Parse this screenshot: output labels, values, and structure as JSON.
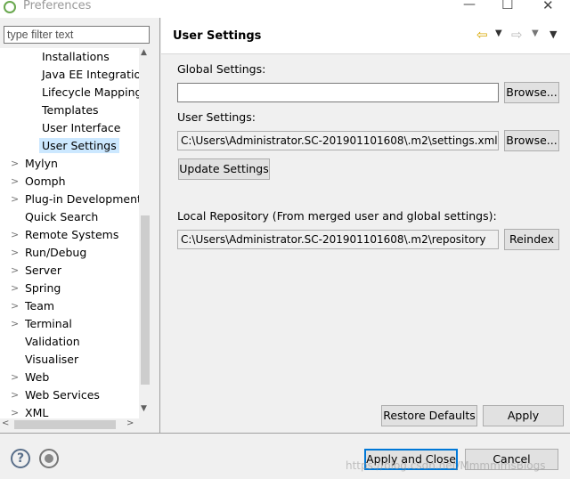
{
  "window": {
    "title": "Preferences"
  },
  "filter": {
    "placeholder": "type filter text"
  },
  "tree": {
    "items": [
      {
        "label": "Installations",
        "expandable": false
      },
      {
        "label": "Java EE Integration",
        "expandable": false
      },
      {
        "label": "Lifecycle Mapping",
        "expandable": false
      },
      {
        "label": "Templates",
        "expandable": false
      },
      {
        "label": "User Interface",
        "expandable": false
      },
      {
        "label": "User Settings",
        "expandable": false,
        "selected": true
      },
      {
        "label": "Mylyn",
        "expandable": true
      },
      {
        "label": "Oomph",
        "expandable": true
      },
      {
        "label": "Plug-in Development",
        "expandable": true
      },
      {
        "label": "Quick Search",
        "expandable": false
      },
      {
        "label": "Remote Systems",
        "expandable": true
      },
      {
        "label": "Run/Debug",
        "expandable": true
      },
      {
        "label": "Server",
        "expandable": true
      },
      {
        "label": "Spring",
        "expandable": true
      },
      {
        "label": "Team",
        "expandable": true
      },
      {
        "label": "Terminal",
        "expandable": true
      },
      {
        "label": "Validation",
        "expandable": false
      },
      {
        "label": "Visualiser",
        "expandable": false
      },
      {
        "label": "Web",
        "expandable": true
      },
      {
        "label": "Web Services",
        "expandable": true
      },
      {
        "label": "XML",
        "expandable": true
      }
    ]
  },
  "page": {
    "title": "User Settings",
    "global_settings_label": "Global Settings:",
    "global_settings_value": "",
    "browse_label": "Browse...",
    "user_settings_label": "User Settings:",
    "user_settings_value": "C:\\Users\\Administrator.SC-201901101608\\.m2\\settings.xml",
    "update_settings_label": "Update Settings",
    "local_repo_label": "Local Repository (From merged user and global settings):",
    "local_repo_value": "C:\\Users\\Administrator.SC-201901101608\\.m2\\repository",
    "reindex_label": "Reindex",
    "restore_defaults_label": "Restore Defaults",
    "apply_label": "Apply"
  },
  "footer": {
    "apply_close_label": "Apply and Close",
    "cancel_label": "Cancel",
    "watermark": "https://blog.csdn.net/MmmmmsBlogs"
  },
  "colors": {
    "selection": "#cce8ff",
    "default_button_border": "#0078d7"
  }
}
